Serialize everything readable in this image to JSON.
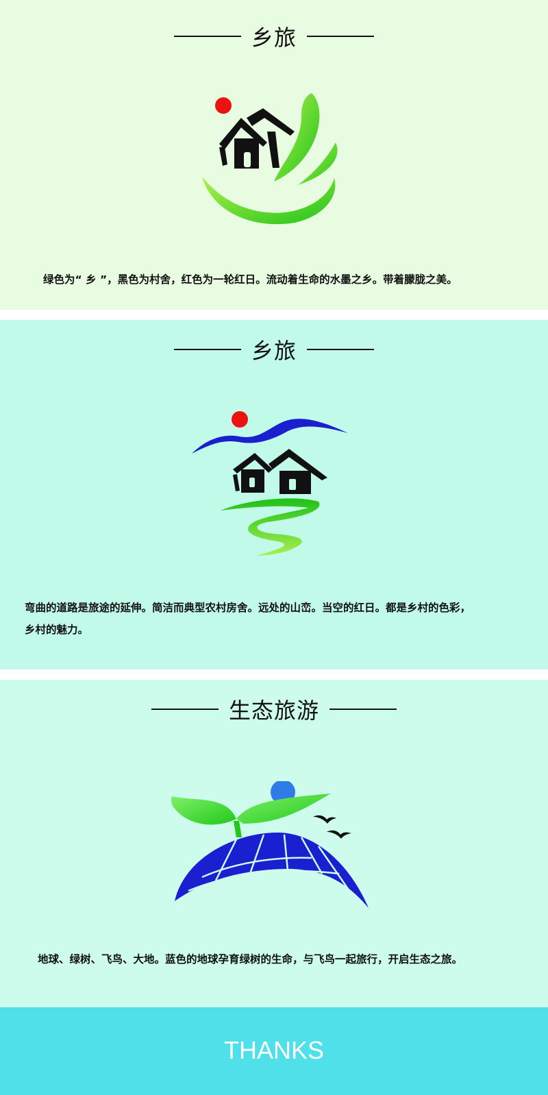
{
  "sections": [
    {
      "heading": "乡旅",
      "description": "绿色为“ 乡 ”，黑色为村舍，红色为一轮红日。流动着生命的水墨之乡。带着朦胧之美。"
    },
    {
      "heading": "乡旅",
      "description_lines": [
        "弯曲的道路是旅途的延伸。简洁而典型农村房舍。远处的山峦。当空的红日。都是乡村的色彩，",
        "乡村的魅力。"
      ]
    },
    {
      "heading": "生态旅游",
      "description": "地球、绿树、飞鸟、大地。蓝色的地球孕育绿树的生命，与飞鸟一起旅行，开启生态之旅。"
    }
  ],
  "footer": {
    "text": "THANKS"
  },
  "colors": {
    "panel1_bg": "#e8fce1",
    "panel2_bg": "#c2fae9",
    "panel3_bg": "#cdfcec",
    "footer_bg": "#4fe0ea",
    "sun_red": "#ee1111",
    "leaf_green": "#3fd81f",
    "earth_blue": "#1a1fcf",
    "sun_blue": "#2f7be8"
  },
  "icons": [
    "village-ink-logo",
    "mountain-road-logo",
    "eco-earth-sprout-logo"
  ]
}
